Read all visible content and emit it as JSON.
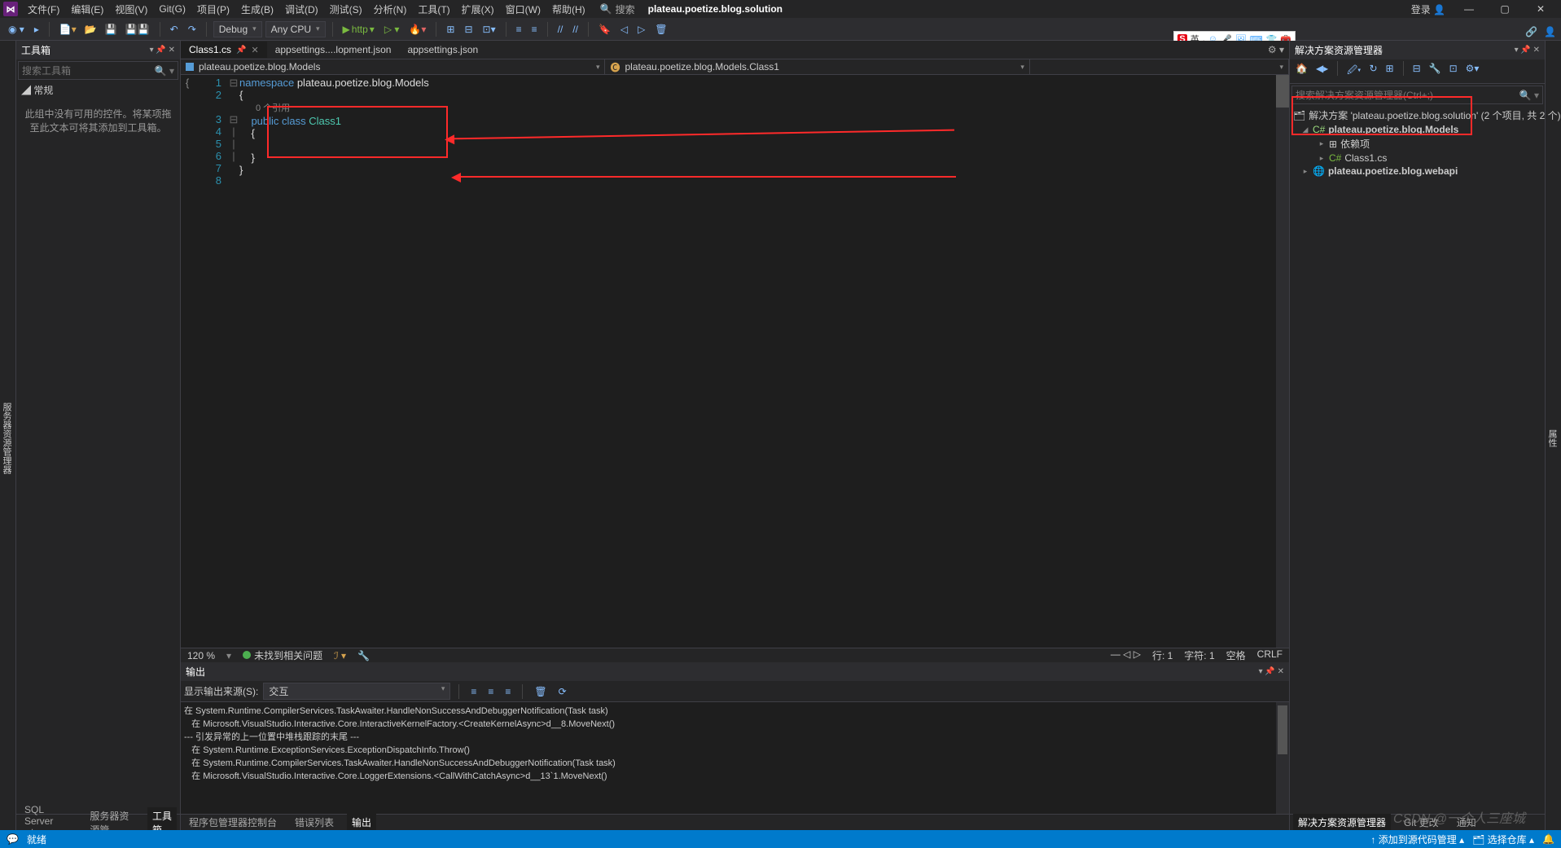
{
  "menu": {
    "file": "文件(F)",
    "edit": "编辑(E)",
    "view": "视图(V)",
    "git": "Git(G)",
    "project": "项目(P)",
    "build": "生成(B)",
    "debug": "调试(D)",
    "test": "测试(S)",
    "analyze": "分析(N)",
    "tools": "工具(T)",
    "ext": "扩展(X)",
    "window": "窗口(W)",
    "help": "帮助(H)"
  },
  "title": {
    "search": "搜索",
    "solution": "plateau.poetize.blog.solution",
    "signin": "登录"
  },
  "toolbar": {
    "config": "Debug",
    "platform": "Any CPU",
    "http": "http"
  },
  "ime": {
    "lang": "英",
    "comma": ",",
    "period": "。"
  },
  "toolbox": {
    "title": "工具箱",
    "search_ph": "搜索工具箱",
    "group": "常规",
    "empty": "此组中没有可用的控件。将某项拖至此文本可将其添加到工具箱。"
  },
  "tabs": {
    "t1": "Class1.cs",
    "t2": "appsettings....lopment.json",
    "t3": "appsettings.json"
  },
  "nav": {
    "proj": "plateau.poetize.blog.Models",
    "type": "plateau.poetize.blog.Models.Class1"
  },
  "code": {
    "ns_kw": "namespace",
    "ns": " plateau.poetize.blog.Models",
    "codelens": "0 个引用",
    "pub": "public ",
    "cls": "class ",
    "name": "Class1",
    "lbrace": "{",
    "rbrace": "}"
  },
  "estatus": {
    "zoom": "120 %",
    "issues": "未找到相关问题",
    "line": "行: 1",
    "char": "字符: 1",
    "spaces": "空格",
    "crlf": "CRLF"
  },
  "output": {
    "title": "输出",
    "from": "显示输出来源(S):",
    "src": "交互",
    "l1": "在 System.Runtime.CompilerServices.TaskAwaiter.HandleNonSuccessAndDebuggerNotification(Task task)",
    "l2": "   在 Microsoft.VisualStudio.Interactive.Core.InteractiveKernelFactory.<CreateKernelAsync>d__8.MoveNext()",
    "l3": "--- 引发异常的上一位置中堆栈跟踪的末尾 ---",
    "l4": "   在 System.Runtime.ExceptionServices.ExceptionDispatchInfo.Throw()",
    "l5": "   在 System.Runtime.CompilerServices.TaskAwaiter.HandleNonSuccessAndDebuggerNotification(Task task)",
    "l6": "   在 Microsoft.VisualStudio.Interactive.Core.LoggerExtensions.<CallWithCatchAsync>d__13`1.MoveNext()"
  },
  "ctabs": {
    "t1": "程序包管理器控制台",
    "t2": "错误列表",
    "t3": "输出"
  },
  "ltabs": {
    "t1": "SQL Server 对...",
    "t2": "服务器资源管...",
    "t3": "工具箱"
  },
  "sln": {
    "title": "解决方案资源管理器",
    "search_ph": "搜索解决方案资源管理器(Ctrl+;)",
    "root": "解决方案 'plateau.poetize.blog.solution' (2 个项目, 共 2 个)",
    "p1": "plateau.poetize.blog.Models",
    "deps": "依赖项",
    "class1": "Class1.cs",
    "p2": "plateau.poetize.blog.webapi"
  },
  "rtabs": {
    "t1": "解决方案资源管理器",
    "t2": "Git 更改",
    "t3": "通知"
  },
  "status": {
    "ready": "就绪",
    "add": "添加到源代码管理",
    "repo": "选择仓库"
  },
  "watermark": "CSDN @一个人三座城",
  "side": {
    "left": "服务器资源管理器",
    "right": "属性"
  }
}
